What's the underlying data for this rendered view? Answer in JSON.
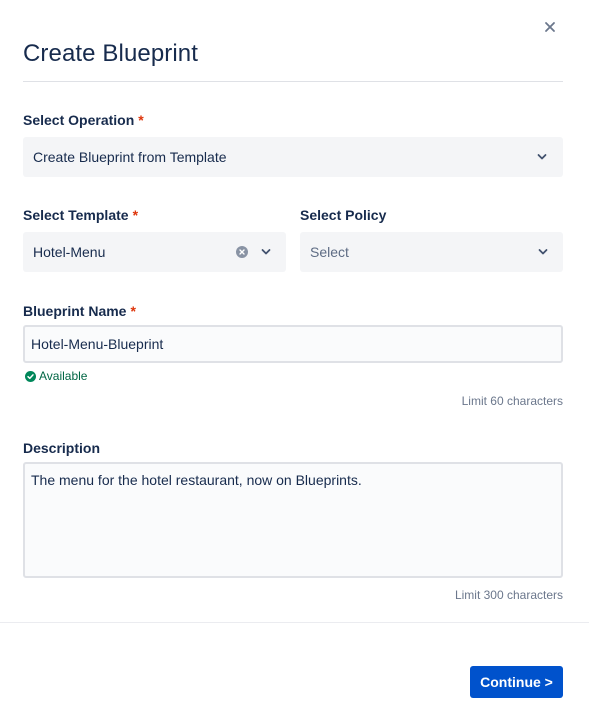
{
  "modal": {
    "title": "Create Blueprint",
    "close_icon": "close-icon"
  },
  "operation": {
    "label": "Select Operation",
    "required_marker": "*",
    "selected": "Create Blueprint from Template"
  },
  "template": {
    "label": "Select Template",
    "required_marker": "*",
    "selected": "Hotel-Menu"
  },
  "policy": {
    "label": "Select Policy",
    "placeholder": "Select"
  },
  "blueprint_name": {
    "label": "Blueprint Name",
    "required_marker": "*",
    "value": "Hotel-Menu-Blueprint",
    "status": "Available",
    "limit": "Limit 60 characters"
  },
  "description": {
    "label": "Description",
    "value": "The menu for the hotel restaurant, now on Blueprints.",
    "limit": "Limit 300 characters"
  },
  "footer": {
    "continue_label": "Continue >"
  },
  "colors": {
    "primary": "#0052cc",
    "required": "#de350b",
    "success": "#006644",
    "field_bg": "#f4f5f7",
    "text": "#172b4d"
  }
}
